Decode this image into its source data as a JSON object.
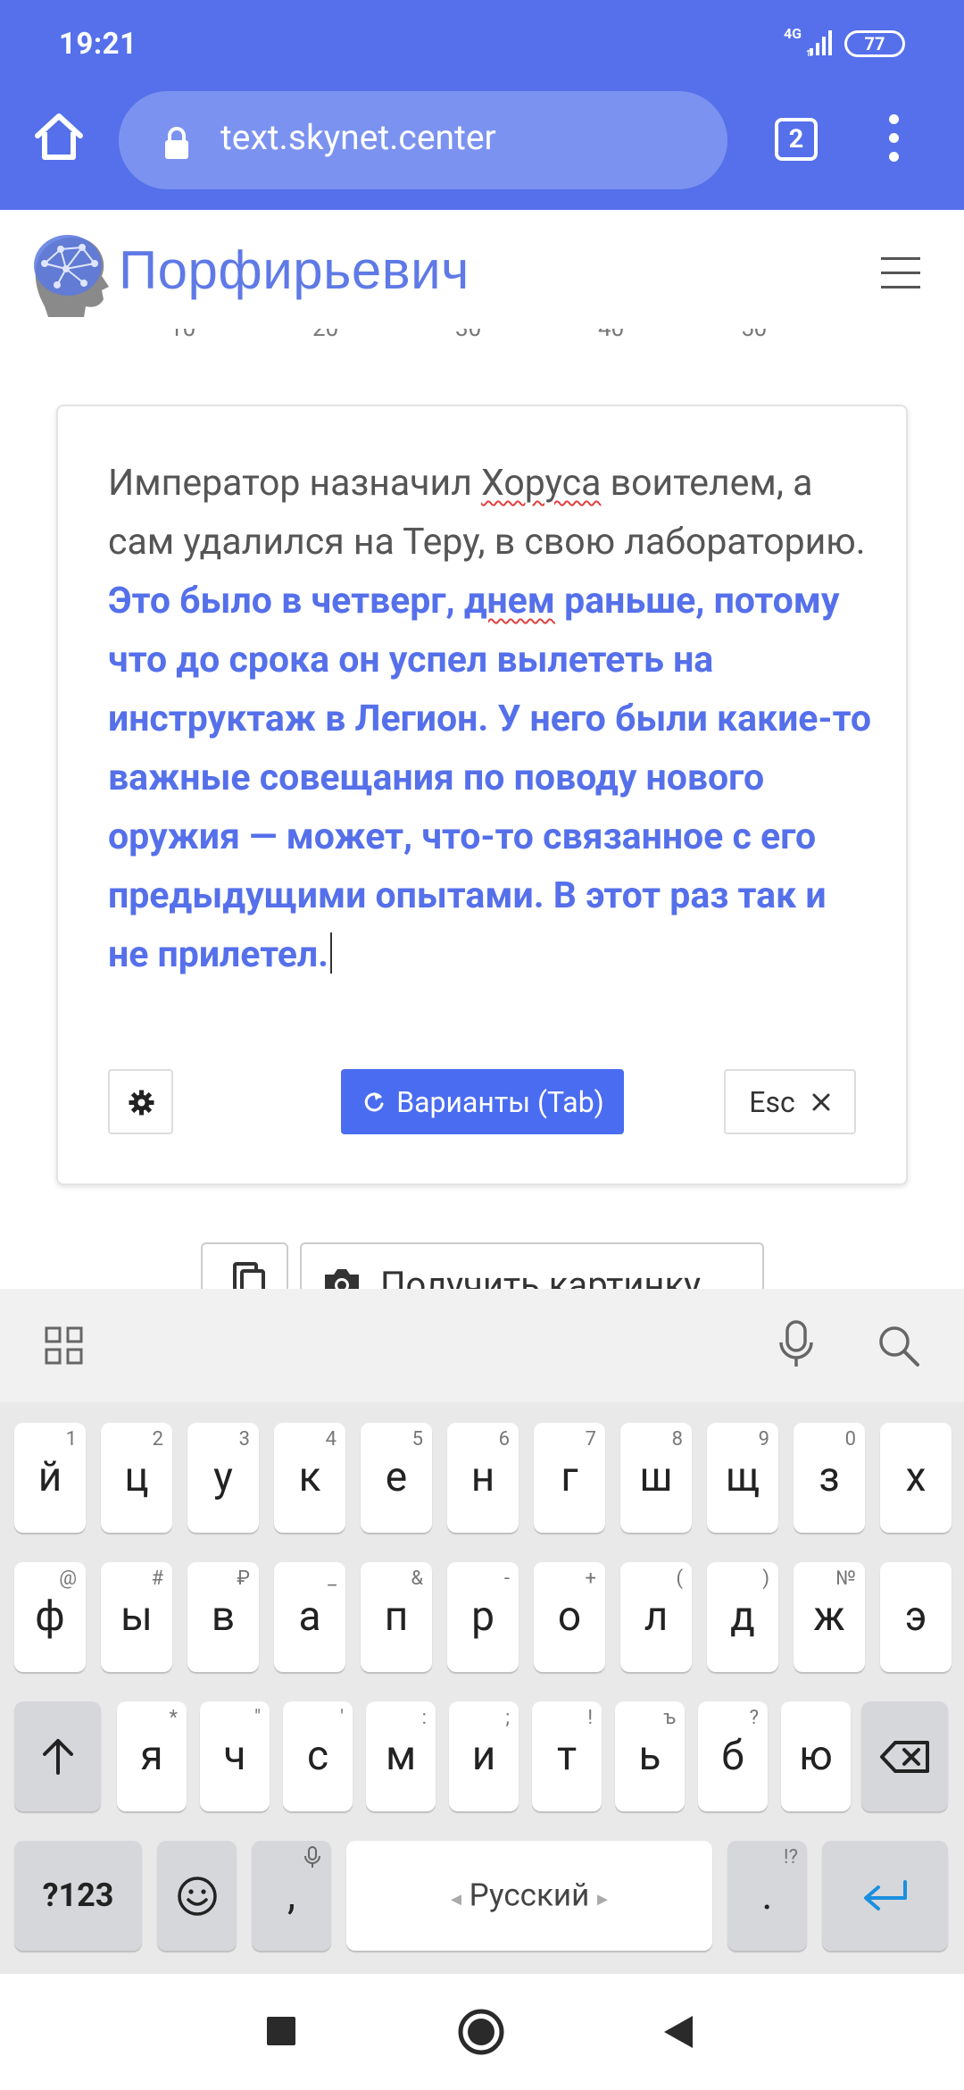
{
  "status_bar": {
    "time": "19:21",
    "network": "4G",
    "battery": "77"
  },
  "browser": {
    "url": "text.skynet.center",
    "tab_count": "2"
  },
  "site": {
    "brand": "Порфирьевич"
  },
  "editor": {
    "user_text_1": "Император назначил ",
    "user_text_typo": "Хоруса",
    "user_text_2": " воителем, а сам удалился  на Теру, в свою лабораторию.  ",
    "generated_typo": "днем",
    "generated_lead": "Это было в четверг, ",
    "generated_rest": " раньше, потому что до срока он успел вылететь на инструктаж в Легион. У него были какие-то важные совещания по поводу нового оружия — может, что-то связанное с его предыдущими опытами. В этот раз так и не прилетел.",
    "variants_label": "Варианты (Tab)",
    "esc_label": "Esc"
  },
  "below_card": {
    "picture_button": "Получить картинку"
  },
  "keyboard": {
    "row1": [
      {
        "k": "й",
        "h": "1"
      },
      {
        "k": "ц",
        "h": "2"
      },
      {
        "k": "у",
        "h": "3"
      },
      {
        "k": "к",
        "h": "4"
      },
      {
        "k": "е",
        "h": "5"
      },
      {
        "k": "н",
        "h": "6"
      },
      {
        "k": "г",
        "h": "7"
      },
      {
        "k": "ш",
        "h": "8"
      },
      {
        "k": "щ",
        "h": "9"
      },
      {
        "k": "з",
        "h": "0"
      },
      {
        "k": "х",
        "h": ""
      }
    ],
    "row2": [
      {
        "k": "ф",
        "h": "@"
      },
      {
        "k": "ы",
        "h": "#"
      },
      {
        "k": "в",
        "h": "₽"
      },
      {
        "k": "а",
        "h": "_"
      },
      {
        "k": "п",
        "h": "&"
      },
      {
        "k": "р",
        "h": "-"
      },
      {
        "k": "о",
        "h": "+"
      },
      {
        "k": "л",
        "h": "("
      },
      {
        "k": "д",
        "h": ")"
      },
      {
        "k": "ж",
        "h": "№"
      },
      {
        "k": "э",
        "h": ""
      }
    ],
    "row3": [
      {
        "k": "я",
        "h": "*"
      },
      {
        "k": "ч",
        "h": "\""
      },
      {
        "k": "с",
        "h": "'"
      },
      {
        "k": "м",
        "h": ":"
      },
      {
        "k": "и",
        "h": ";"
      },
      {
        "k": "т",
        "h": "!"
      },
      {
        "k": "ь",
        "h": "ъ"
      },
      {
        "k": "б",
        "h": "?"
      },
      {
        "k": "ю",
        "h": ""
      }
    ],
    "numbers_key": "?123",
    "comma": ",",
    "period": ".",
    "period_hint": "!?",
    "space_label": "Русский"
  }
}
